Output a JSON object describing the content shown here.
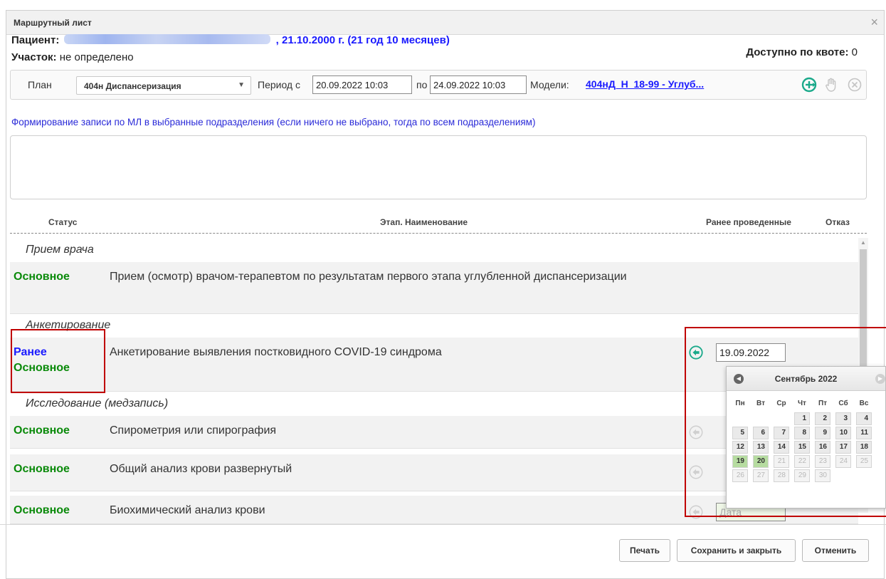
{
  "dialog": {
    "title": "Маршрутный лист",
    "close_icon": "×"
  },
  "patient": {
    "label": "Пациент:",
    "birth_info": ", 21.10.2000 г. (21 год 10 месяцев)",
    "site_label": "Участок:",
    "site_value": " не определено",
    "quota_label": "Доступно по квоте:",
    "quota_value": " 0"
  },
  "plan_bar": {
    "plan_label": "План",
    "plan_selected": "404н Диспансеризация",
    "period_label": "Период с",
    "date_from": "20.09.2022 10:03",
    "po_label": "по",
    "date_to": "24.09.2022 10:03",
    "models_label": "Модели:",
    "models_link": "404нД_Н_18-99 - Углуб..."
  },
  "formation_text": "Формирование записи по МЛ в выбранные подразделения (если ничего не выбрано, тогда по всем подразделениям)",
  "table_headers": {
    "status": "Статус",
    "name": "Этап. Наименование",
    "previous": "Ранее проведенные",
    "refusal": "Отказ"
  },
  "sections": {
    "s1": "Прием врача",
    "s2": "Анкетирование",
    "s3": "Исследование (медзапись)"
  },
  "rows": {
    "r1": {
      "status": "Основное",
      "name": "Прием (осмотр) врачом-терапевтом по результатам первого этапа углубленной диспансеризации"
    },
    "r2": {
      "status_top": "Ранее",
      "status": "Основное",
      "name": "Анкетирование выявления постковидного COVID-19 синдрома",
      "date": "19.09.2022"
    },
    "r3": {
      "status": "Основное",
      "name": "Спирометрия или спирография"
    },
    "r4": {
      "status": "Основное",
      "name": "Общий анализ крови развернутый"
    },
    "r5": {
      "status": "Основное",
      "name": "Биохимический анализ крови",
      "date_placeholder": "Дата"
    }
  },
  "calendar": {
    "month": "Сентябрь 2022",
    "weekdays": [
      "Пн",
      "Вт",
      "Ср",
      "Чт",
      "Пт",
      "Сб",
      "Вс"
    ],
    "weeks": [
      [
        "",
        "",
        "",
        "1",
        "2",
        "3",
        "4"
      ],
      [
        "5",
        "6",
        "7",
        "8",
        "9",
        "10",
        "11"
      ],
      [
        "12",
        "13",
        "14",
        "15",
        "16",
        "17",
        "18"
      ],
      [
        "19",
        "20",
        "21",
        "22",
        "23",
        "24",
        "25"
      ],
      [
        "26",
        "27",
        "28",
        "29",
        "30",
        "",
        ""
      ]
    ],
    "highlighted_days": [
      "19",
      "20"
    ],
    "disabled_from": "21"
  },
  "buttons": {
    "print": "Печать",
    "save_close": "Сохранить и закрыть",
    "cancel": "Отменить"
  },
  "colors": {
    "status_green": "#0a8a0a",
    "status_blue": "#1a1aff",
    "link_blue": "#1a1aff",
    "highlight_red": "#c00000",
    "icon_teal": "#1aa98a"
  }
}
